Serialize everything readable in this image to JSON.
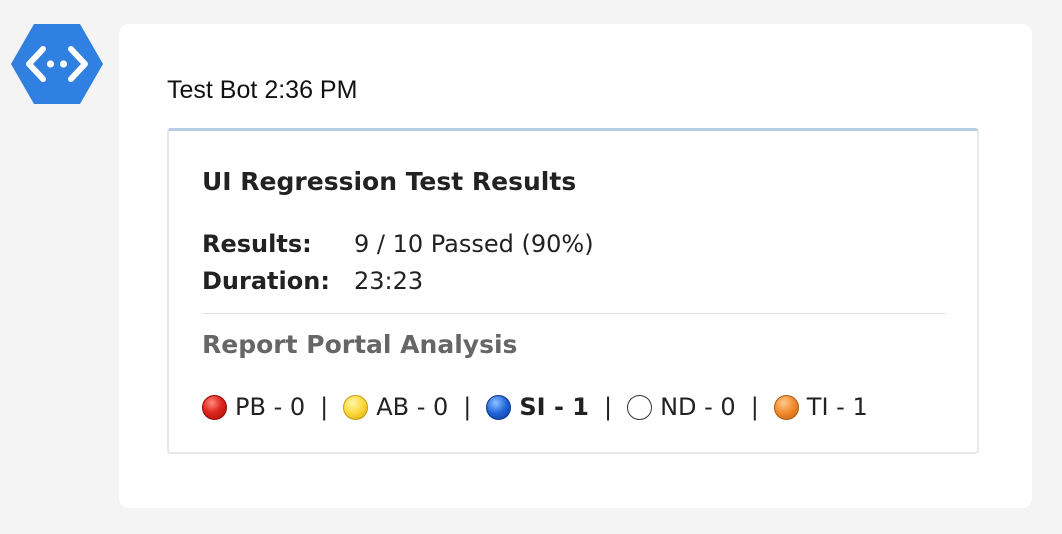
{
  "bot": {
    "name": "Test Bot",
    "time": "2:36 PM",
    "avatar_icon": "bot-code-hexagon-icon",
    "avatar_color": "#2f80e0"
  },
  "card": {
    "title": "UI Regression Test Results",
    "facts": [
      {
        "label": "Results:",
        "value": "9 / 10 Passed (90%)"
      },
      {
        "label": "Duration:",
        "value": "23:23"
      }
    ],
    "analysis_title": "Report Portal Analysis",
    "separator": "|",
    "defects": [
      {
        "icon": "red-circle-icon",
        "text": "PB - 0",
        "color": "#e0261c"
      },
      {
        "icon": "yellow-circle-icon",
        "text": "AB - 0",
        "color": "#fbd93a"
      },
      {
        "icon": "blue-circle-icon",
        "text": "SI - 1",
        "color": "#1f63d8"
      },
      {
        "icon": "white-circle-icon",
        "text": "ND - 0",
        "color": "#ffffff"
      },
      {
        "icon": "orange-circle-icon",
        "text": "TI - 1",
        "color": "#f0882c"
      }
    ]
  }
}
